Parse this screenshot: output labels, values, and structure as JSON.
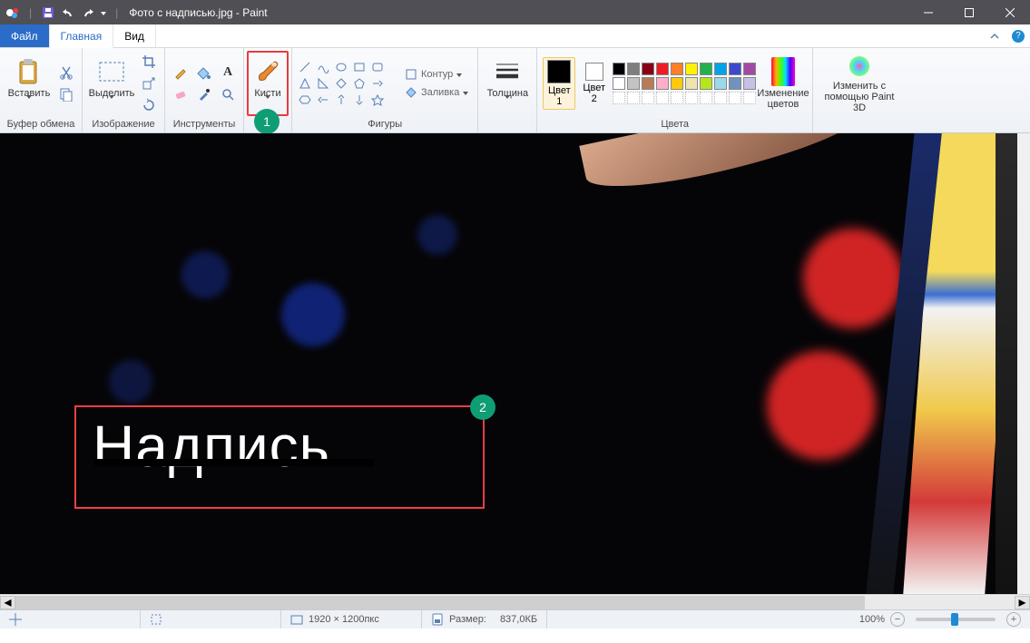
{
  "titlebar": {
    "document": "Фото с надписью.jpg",
    "app": "Paint"
  },
  "tabs": {
    "file": "Файл",
    "home": "Главная",
    "view": "Вид"
  },
  "ribbon": {
    "clipboard": {
      "paste": "Вставить",
      "group": "Буфер обмена"
    },
    "image": {
      "select": "Выделить",
      "group": "Изображение"
    },
    "tools": {
      "group": "Инструменты"
    },
    "brushes": {
      "label": "Кисти"
    },
    "shapes": {
      "outline": "Контур",
      "fill": "Заливка",
      "group": "Фигуры"
    },
    "thickness": {
      "label": "Толщина"
    },
    "colors": {
      "c1": "Цвет\n1",
      "c2": "Цвет\n2",
      "edit": "Изменение\nцветов",
      "group": "Цвета",
      "c1_value": "#000000",
      "c2_value": "#ffffff",
      "palette_row1": [
        "#000000",
        "#7f7f7f",
        "#880015",
        "#ed1c24",
        "#ff7f27",
        "#fff200",
        "#22b14c",
        "#00a2e8",
        "#3f48cc",
        "#a349a4"
      ],
      "palette_row2": [
        "#ffffff",
        "#c3c3c3",
        "#b97a57",
        "#ffaec9",
        "#ffc90e",
        "#efe4b0",
        "#b5e61d",
        "#99d9ea",
        "#7092be",
        "#c8bfe7"
      ]
    },
    "paint3d": {
      "label": "Изменить с\nпомощью Paint 3D"
    }
  },
  "canvas": {
    "overlay_text": "Надпись"
  },
  "annotations": {
    "badge1": "1",
    "badge2": "2"
  },
  "status": {
    "dimensions": "1920 × 1200пкс",
    "size_label": "Размер:",
    "size_value": "837,0КБ",
    "zoom": "100%"
  }
}
